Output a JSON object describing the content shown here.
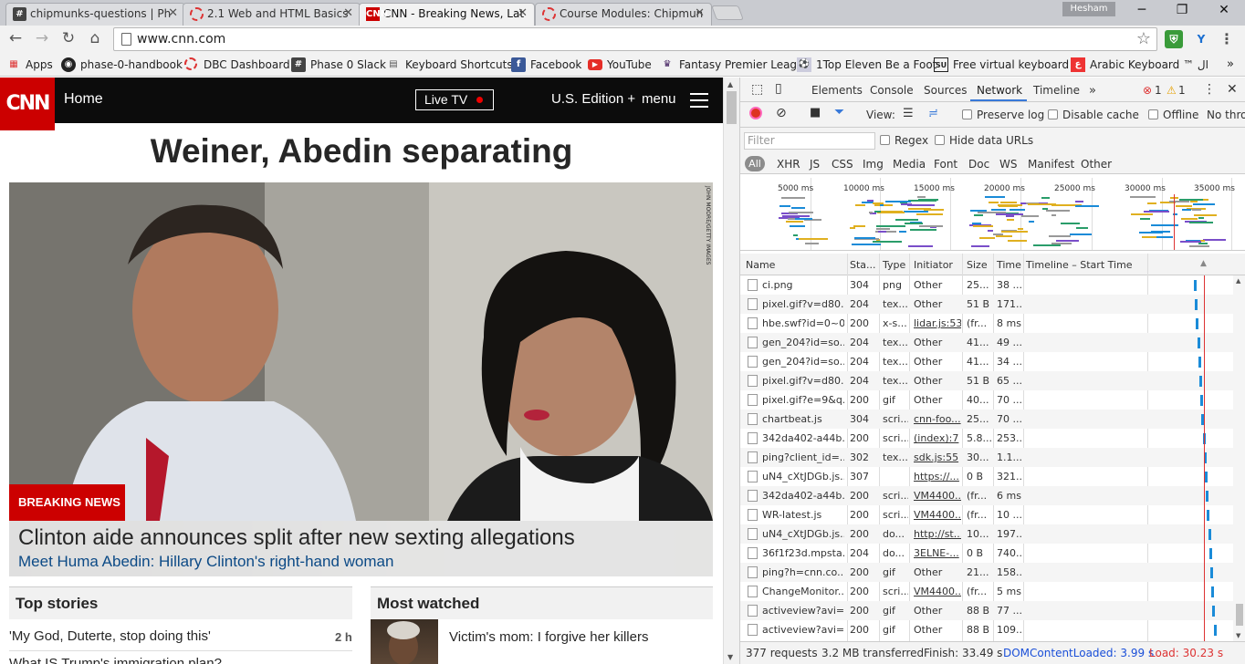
{
  "tabs": [
    {
      "title": "chipmunks-questions | Ph",
      "icon": "hash-icon",
      "active": false
    },
    {
      "title": "2.1 Web and HTML Basics",
      "icon": "ring-icon",
      "active": false
    },
    {
      "title": "CNN - Breaking News, Lat",
      "icon": "cnn-icon",
      "active": true
    },
    {
      "title": "Course Modules: Chipmun",
      "icon": "ring-icon",
      "active": false
    }
  ],
  "user_name": "Hesham",
  "address_bar": {
    "url": "www.cnn.com"
  },
  "bookmarks": [
    {
      "label": "Apps",
      "icon": "apps-grid-icon"
    },
    {
      "label": "phase-0-handbook",
      "icon": "github-icon"
    },
    {
      "label": "DBC Dashboard",
      "icon": "ring-icon"
    },
    {
      "label": "Phase 0 Slack",
      "icon": "hash-icon"
    },
    {
      "label": "Keyboard Shortcuts",
      "icon": "keyboard-icon"
    },
    {
      "label": "Facebook",
      "icon": "facebook-icon"
    },
    {
      "label": "YouTube",
      "icon": "youtube-icon"
    },
    {
      "label": "Fantasy Premier Leagu",
      "icon": "premier-league-icon"
    },
    {
      "label": "1Top Eleven Be a Foot",
      "icon": "top-eleven-icon"
    },
    {
      "label": "Free virtual keyboard",
      "icon": "su-icon"
    },
    {
      "label": "Arabic Keyboard ™ ال",
      "icon": "arabic-keyboard-icon"
    }
  ],
  "cnn": {
    "logo": "CNN",
    "home": "Home",
    "live_tv": "Live TV",
    "edition": "U.S. Edition +",
    "menu": "menu",
    "headline": "Weiner, Abedin separating",
    "photo_credit": "JOHN MOORE/GETTY IMAGES",
    "breaking_label": "BREAKING NEWS",
    "hero_title": "Clinton aide announces split after new sexting allegations",
    "hero_link": "Meet Huma Abedin: Hillary Clinton's right-hand woman",
    "top_stories": {
      "heading": "Top stories",
      "items": [
        {
          "title": "'My God, Duterte, stop doing this'",
          "age": "2 h"
        },
        {
          "title": "What IS Trump's immigration plan?",
          "age": ""
        }
      ]
    },
    "most_watched": {
      "heading": "Most watched",
      "items": [
        {
          "title": "Victim's mom: I forgive her killers"
        }
      ]
    }
  },
  "devtools": {
    "tabs": [
      "Elements",
      "Console",
      "Sources",
      "Network",
      "Timeline"
    ],
    "active_tab": "Network",
    "error_count": "1",
    "warning_count": "1",
    "view_label": "View:",
    "preserve_log": "Preserve log",
    "disable_cache": "Disable cache",
    "offline": "Offline",
    "throttle": "No thrott",
    "filter_placeholder": "Filter",
    "regex": "Regex",
    "hide_data_urls": "Hide data URLs",
    "types": [
      "All",
      "XHR",
      "JS",
      "CSS",
      "Img",
      "Media",
      "Font",
      "Doc",
      "WS",
      "Manifest",
      "Other"
    ],
    "overview_ticks": [
      "5000 ms",
      "10000 ms",
      "15000 ms",
      "20000 ms",
      "25000 ms",
      "30000 ms",
      "35000 ms"
    ],
    "columns": [
      "Name",
      "Sta...",
      "Type",
      "Initiator",
      "Size",
      "Time",
      "Timeline – Start Time"
    ],
    "rows": [
      {
        "name": "ci.png",
        "status": "304",
        "type": "png",
        "initiator": "Other",
        "size": "25...",
        "time": "38 ...",
        "link": false
      },
      {
        "name": "pixel.gif?v=d80...",
        "status": "204",
        "type": "tex...",
        "initiator": "Other",
        "size": "51 B",
        "time": "171...",
        "link": false
      },
      {
        "name": "hbe.swf?id=0~0",
        "status": "200",
        "type": "x-s...",
        "initiator": "lidar.js:53",
        "size": "(fr...",
        "time": "8 ms",
        "link": true
      },
      {
        "name": "gen_204?id=so...",
        "status": "204",
        "type": "tex...",
        "initiator": "Other",
        "size": "41...",
        "time": "49 ...",
        "link": false
      },
      {
        "name": "gen_204?id=so...",
        "status": "204",
        "type": "tex...",
        "initiator": "Other",
        "size": "41...",
        "time": "34 ...",
        "link": false
      },
      {
        "name": "pixel.gif?v=d80...",
        "status": "204",
        "type": "tex...",
        "initiator": "Other",
        "size": "51 B",
        "time": "65 ...",
        "link": false
      },
      {
        "name": "pixel.gif?e=9&q...",
        "status": "200",
        "type": "gif",
        "initiator": "Other",
        "size": "40...",
        "time": "70 ...",
        "link": false
      },
      {
        "name": "chartbeat.js",
        "status": "304",
        "type": "scri...",
        "initiator": "cnn-foo...",
        "size": "25...",
        "time": "70 ...",
        "link": true
      },
      {
        "name": "342da402-a44b...",
        "status": "200",
        "type": "scri...",
        "initiator": "(index):7",
        "size": "5.8...",
        "time": "253...",
        "link": true
      },
      {
        "name": "ping?client_id=...",
        "status": "302",
        "type": "tex...",
        "initiator": "sdk.js:55",
        "size": "30...",
        "time": "1.1...",
        "link": true
      },
      {
        "name": "uN4_cXtJDGb.js...",
        "status": "307",
        "type": "",
        "initiator": "https://...",
        "size": "0 B",
        "time": "321...",
        "link": true
      },
      {
        "name": "342da402-a44b...",
        "status": "200",
        "type": "scri...",
        "initiator": "VM4400...",
        "size": "(fr...",
        "time": "6 ms",
        "link": true
      },
      {
        "name": "WR-latest.js",
        "status": "200",
        "type": "scri...",
        "initiator": "VM4400...",
        "size": "(fr...",
        "time": "10 ...",
        "link": true
      },
      {
        "name": "uN4_cXtJDGb.js...",
        "status": "200",
        "type": "do...",
        "initiator": "http://st...",
        "size": "10...",
        "time": "197...",
        "link": true
      },
      {
        "name": "36f1f23d.mpsta...",
        "status": "204",
        "type": "do...",
        "initiator": "3ELNE-...",
        "size": "0 B",
        "time": "740...",
        "link": true
      },
      {
        "name": "ping?h=cnn.co...",
        "status": "200",
        "type": "gif",
        "initiator": "Other",
        "size": "21...",
        "time": "158...",
        "link": false
      },
      {
        "name": "ChangeMonitor....",
        "status": "200",
        "type": "scri...",
        "initiator": "VM4400...",
        "size": "(fr...",
        "time": "5 ms",
        "link": true
      },
      {
        "name": "activeview?avi=...",
        "status": "200",
        "type": "gif",
        "initiator": "Other",
        "size": "88 B",
        "time": "77 ...",
        "link": false
      },
      {
        "name": "activeview?avi=...",
        "status": "200",
        "type": "gif",
        "initiator": "Other",
        "size": "88 B",
        "time": "109...",
        "link": false
      }
    ],
    "status_bar": {
      "requests": "377 requests",
      "transferred": "3.2 MB transferred",
      "finish": "Finish: 33.49 s",
      "dom_content_loaded": "DOMContentLoaded: 3.99 s",
      "load": "Load: 30.23 s"
    },
    "colors": {
      "dcl": "#1a4fd8",
      "load": "#d33",
      "accent": "#3879d9"
    }
  }
}
